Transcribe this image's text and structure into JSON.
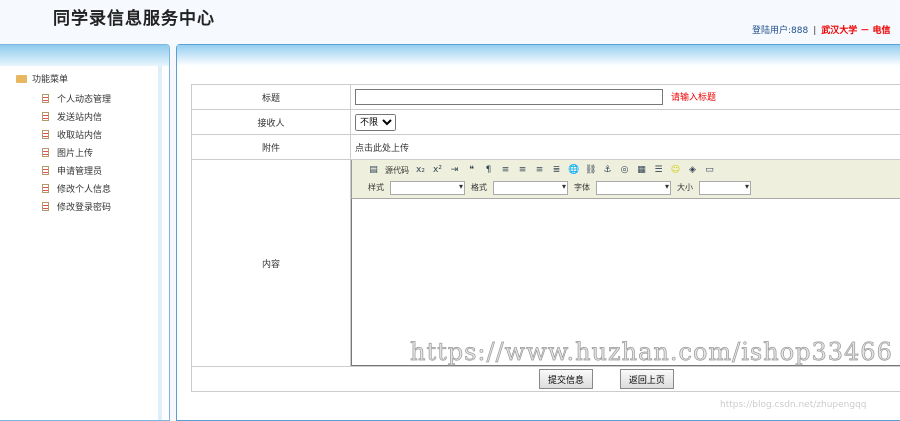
{
  "header": {
    "title": "同学录信息服务中心",
    "user_label": "登陆用户:",
    "user": "888",
    "separator": "|",
    "school": "武汉大学 － 电信"
  },
  "sidebar": {
    "heading": "功能菜单",
    "items": [
      "个人动态管理",
      "发送站内信",
      "收取站内信",
      "图片上传",
      "申请管理员",
      "修改个人信息",
      "修改登录密码"
    ]
  },
  "form": {
    "title_label": "标题",
    "title_value": "",
    "title_hint": "请输入标题",
    "receiver_label": "接收人",
    "receiver_selected": "不限",
    "attachment_label": "附件",
    "attachment_link": "点击此处上传",
    "content_label": "内容",
    "editor": {
      "source_label": "源代码",
      "style_label": "样式",
      "format_label": "格式",
      "font_label": "字体",
      "size_label": "大小"
    },
    "submit_label": "提交信息",
    "back_label": "返回上页"
  },
  "watermarks": [
    "https://www.huzhan.com/ishop33466",
    "https://blog.csdn.net/zhupengqq"
  ]
}
